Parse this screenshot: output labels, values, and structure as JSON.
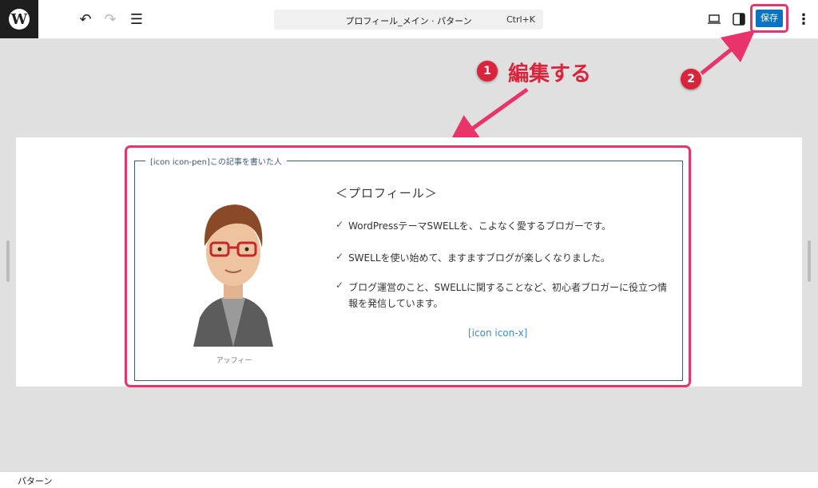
{
  "toolbar": {
    "logo": "W",
    "add_label": "+",
    "undo_icon": "↶",
    "redo_icon": "↷",
    "listview_icon": "☰",
    "document_title": "プロフィール_メイン · パターン",
    "shortcut": "Ctrl+K",
    "save_label": "保存",
    "more_icon": "⋮"
  },
  "annotations": {
    "step1_number": "1",
    "step1_text": "編集する",
    "step2_number": "2",
    "color": "#d9243b"
  },
  "profile": {
    "box_caption": "[icon icon-pen]この記事を書いた人",
    "title": "＜プロフィール＞",
    "check_icon": "✓",
    "items": [
      "WordPressテーマSWELLを、こよなく愛するブロガーです。",
      "SWELLを使い始めて、ますますブログが楽しくなりました。",
      "ブログ運営のこと、SWELLに関することなど、初心者ブロガーに役立つ情報を発信しています。"
    ],
    "icon_link": "[icon icon-x]",
    "avatar_caption": "アッフィー"
  },
  "status": {
    "breadcrumb": "パターン"
  }
}
